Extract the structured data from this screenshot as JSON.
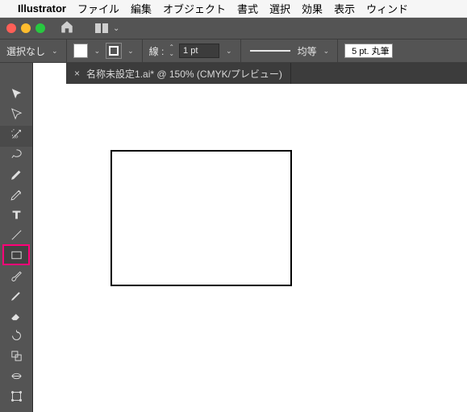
{
  "menubar": {
    "app": "Illustrator",
    "items": [
      "ファイル",
      "編集",
      "オブジェクト",
      "書式",
      "選択",
      "効果",
      "表示",
      "ウィンド"
    ]
  },
  "optbar": {
    "no_selection": "選択なし",
    "stroke_label": "線 :",
    "stroke_weight": "1 pt",
    "profile": "均等",
    "brush": "5 pt. 丸筆"
  },
  "tabs": [
    {
      "close": "×",
      "title": "名称未設定1.ai* @ 150% (CMYK/プレビュー)"
    }
  ],
  "tools": [
    {
      "name": "selection-tool"
    },
    {
      "name": "direct-selection-tool"
    },
    {
      "name": "magic-wand-tool"
    },
    {
      "name": "lasso-tool"
    },
    {
      "name": "pen-tool"
    },
    {
      "name": "curvature-tool"
    },
    {
      "name": "type-tool"
    },
    {
      "name": "line-tool"
    },
    {
      "name": "rectangle-tool",
      "selected": true
    },
    {
      "name": "paintbrush-tool"
    },
    {
      "name": "pencil-tool"
    },
    {
      "name": "eraser-tool"
    },
    {
      "name": "rotate-tool"
    },
    {
      "name": "scale-tool"
    },
    {
      "name": "width-tool"
    },
    {
      "name": "free-transform-tool"
    }
  ]
}
